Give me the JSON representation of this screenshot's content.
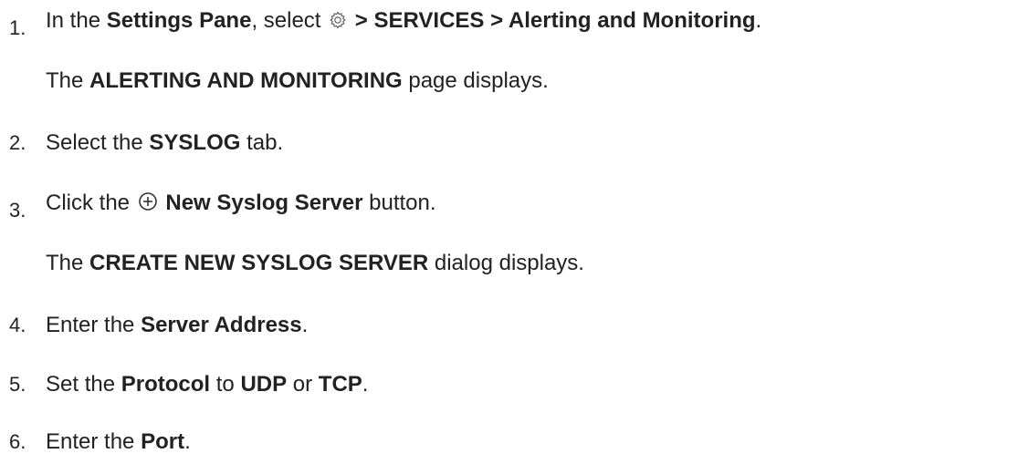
{
  "steps": [
    {
      "number": "1.",
      "parts": [
        "In the ",
        "Settings Pane",
        ", select ",
        " > SERVICES > Alerting and Monitoring",
        "."
      ],
      "icon": "gear-icon",
      "result": {
        "parts": [
          "The ",
          "ALERTING AND MONITORING",
          " page displays."
        ]
      }
    },
    {
      "number": "2.",
      "parts": [
        "Select the ",
        "SYSLOG",
        " tab."
      ]
    },
    {
      "number": "3.",
      "parts": [
        "Click the ",
        " New Syslog Server",
        " button."
      ],
      "icon": "plus-circle-icon",
      "result": {
        "parts": [
          "The ",
          "CREATE NEW SYSLOG SERVER",
          " dialog displays."
        ]
      }
    },
    {
      "number": "4.",
      "parts": [
        "Enter the ",
        "Server Address",
        "."
      ]
    },
    {
      "number": "5.",
      "parts": [
        "Set the ",
        "Protocol",
        " to ",
        "UDP",
        " or ",
        "TCP",
        "."
      ]
    },
    {
      "number": "6.",
      "parts": [
        "Enter the ",
        "Port",
        "."
      ]
    }
  ],
  "colors": {
    "text": "#222222",
    "icon": "#555555"
  }
}
